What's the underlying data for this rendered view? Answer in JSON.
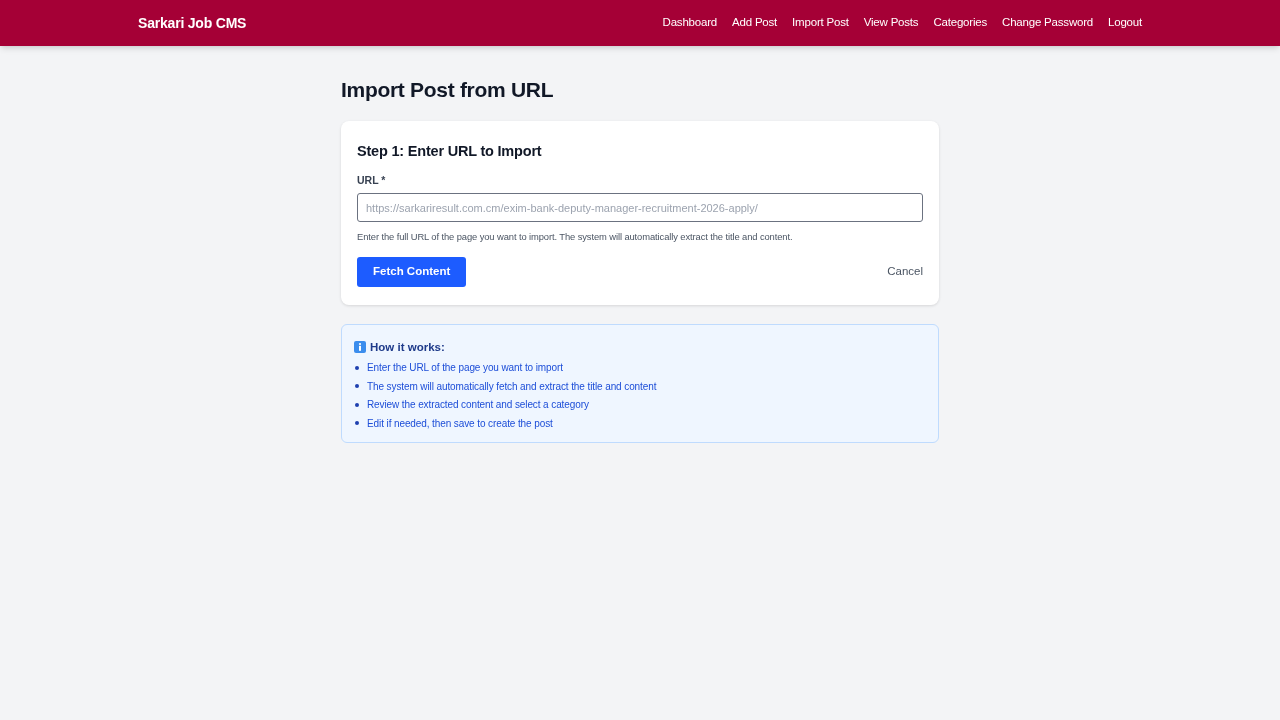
{
  "header": {
    "brand": "Sarkari Job CMS",
    "nav": [
      "Dashboard",
      "Add Post",
      "Import Post",
      "View Posts",
      "Categories",
      "Change Password",
      "Logout"
    ]
  },
  "page_title": "Import Post from URL",
  "step_card": {
    "title": "Step 1: Enter URL to Import",
    "url_field": {
      "label": "URL *",
      "placeholder": "https://sarkariresult.com.cm/exim-bank-deputy-manager-recruitment-2026-apply/"
    },
    "help_text": "Enter the full URL of the page you want to import. The system will automatically extract the title and content.",
    "actions": [
      {
        "label": "Fetch Content",
        "kind": "primary"
      },
      {
        "label": "Cancel",
        "kind": "link"
      }
    ]
  },
  "info_box": {
    "title": "How it works:",
    "items": [
      "Enter the URL of the page you want to import",
      "The system will automatically fetch and extract the title and content",
      "Review the extracted content and select a category",
      "Edit if needed, then save to create the post"
    ]
  }
}
